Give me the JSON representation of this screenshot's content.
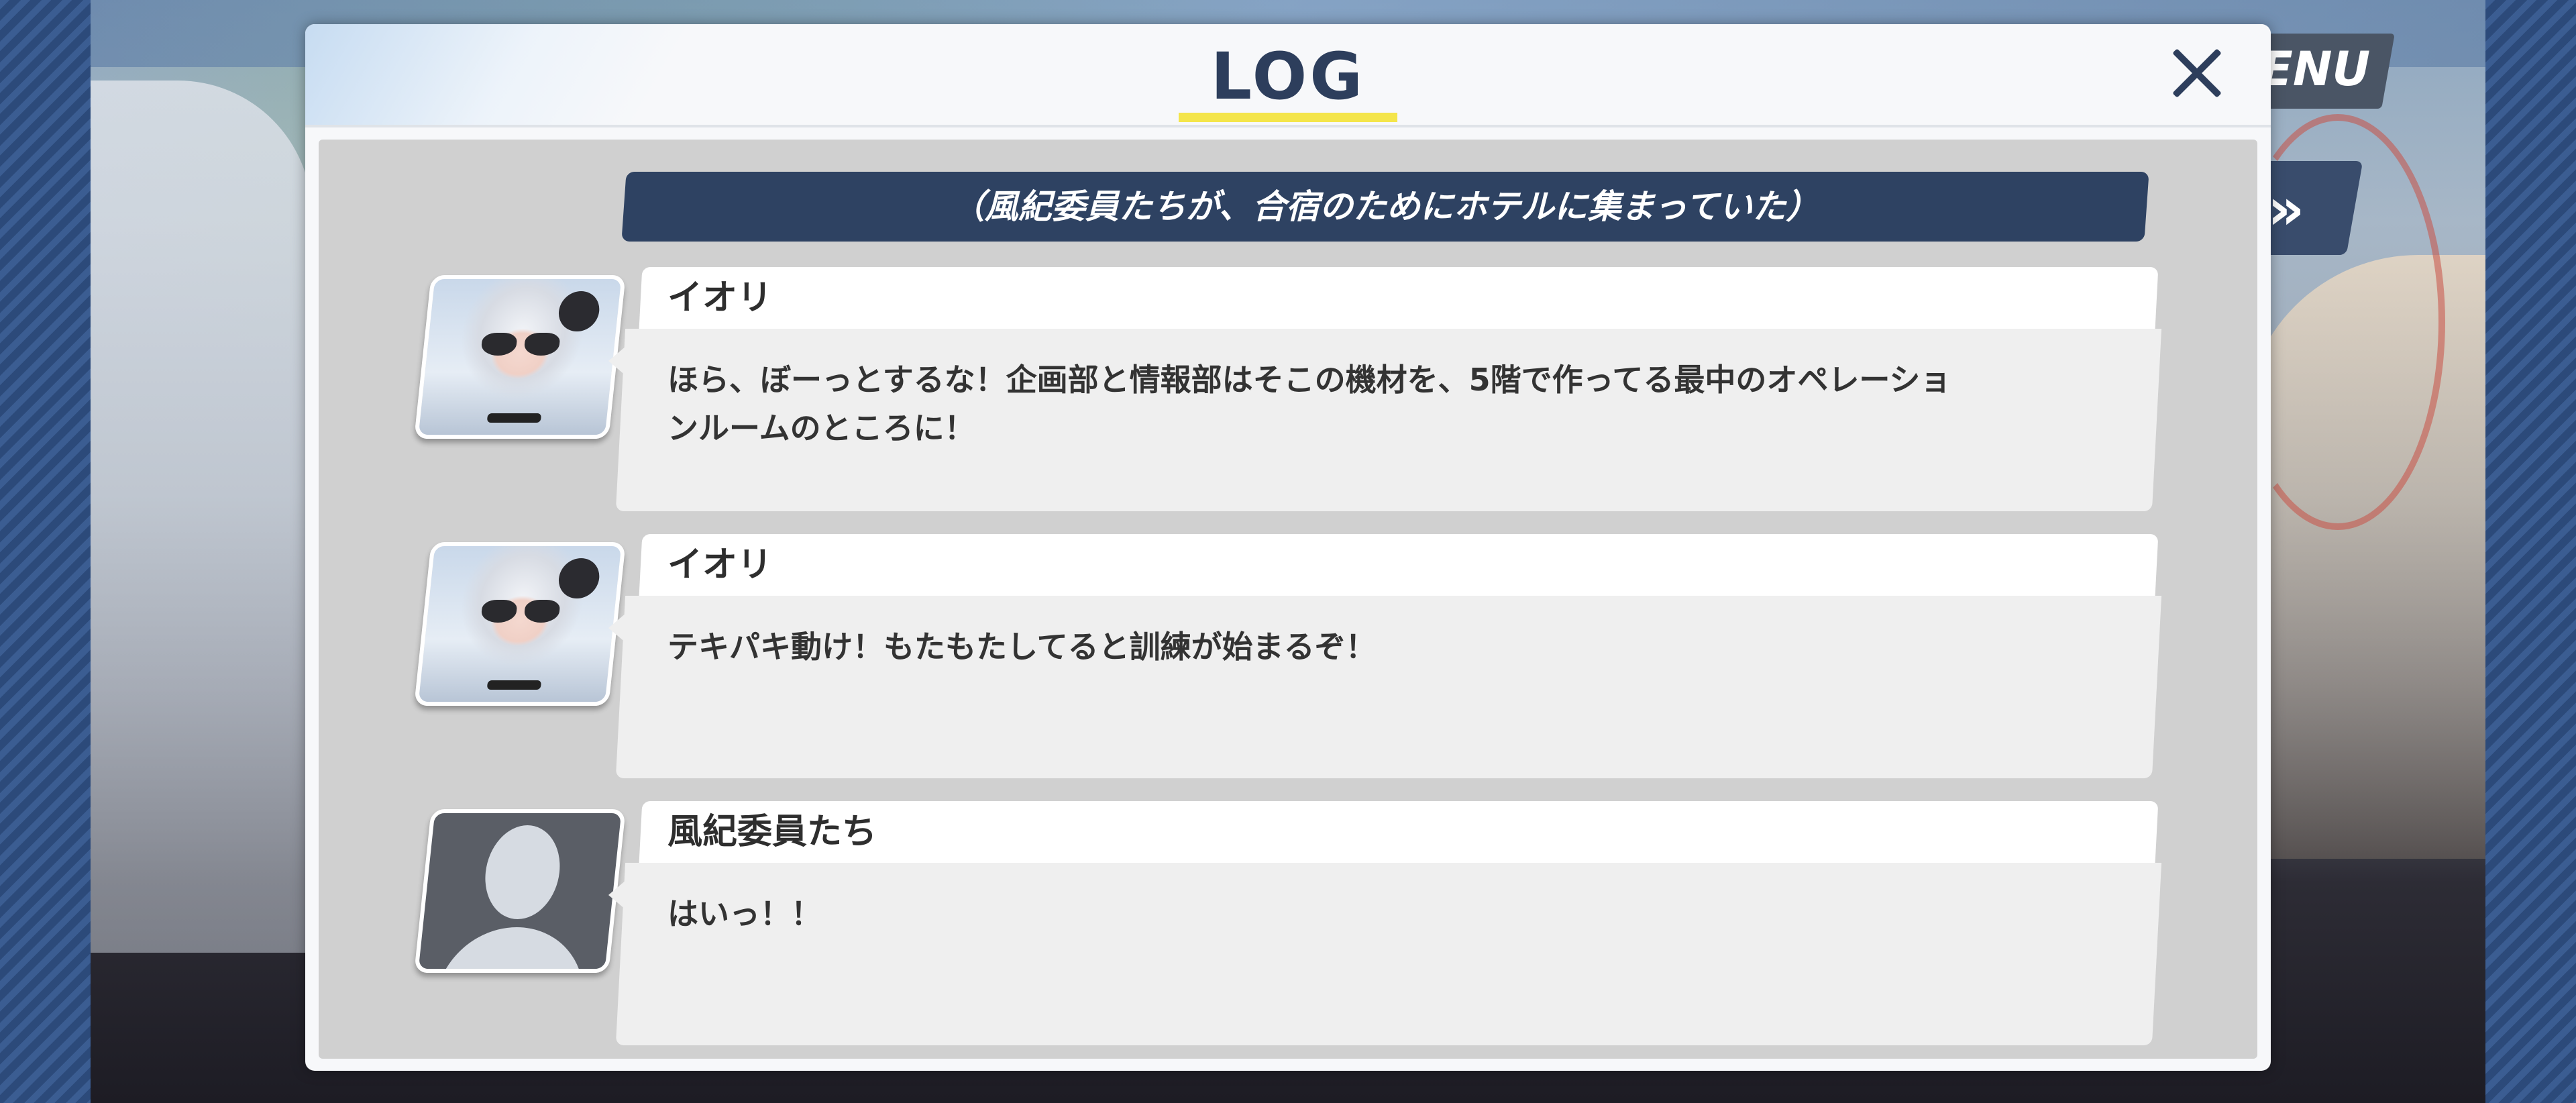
{
  "screen": {
    "menu_label": "ENU",
    "skip_label": "»"
  },
  "log": {
    "title": "LOG",
    "close_icon": "close-icon",
    "narration": "（風紀委員たちが、合宿のためにホテルに集まっていた）",
    "entries": [
      {
        "speaker": "イオリ",
        "avatar": "iori-portrait",
        "text": "ほら、ぼーっとするな！企画部と情報部はそこの機材を、5階で作ってる最中のオペレーショ\nンルームのところに！"
      },
      {
        "speaker": "イオリ",
        "avatar": "iori-portrait",
        "text": "テキパキ動け！もたもたしてると訓練が始まるぞ！"
      },
      {
        "speaker": "風紀委員たち",
        "avatar": "placeholder-silhouette",
        "text": "はいっ！！"
      }
    ]
  },
  "colors": {
    "accent_underline": "#f4e54a",
    "title_text": "#2d3e5c",
    "narration_bg": "#2e4262",
    "border_stripe": "#3b5d92"
  }
}
